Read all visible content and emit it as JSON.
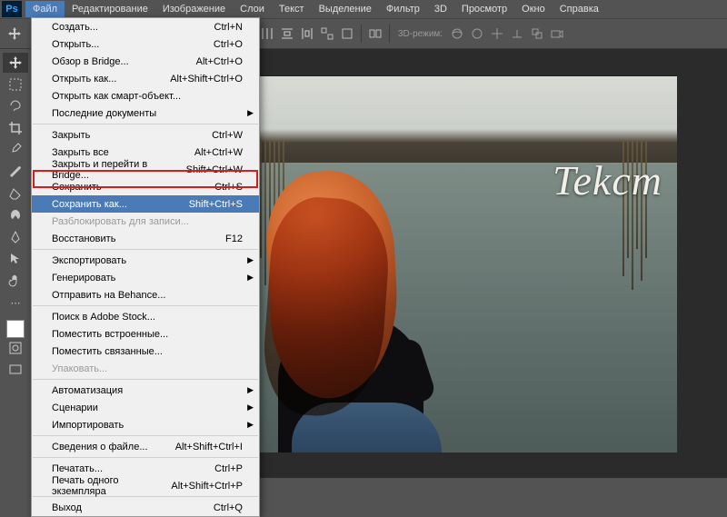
{
  "app": {
    "logo": "Ps"
  },
  "menubar": [
    "Файл",
    "Редактирование",
    "Изображение",
    "Слои",
    "Текст",
    "Выделение",
    "Фильтр",
    "3D",
    "Просмотр",
    "Окно",
    "Справка"
  ],
  "active_menu": 0,
  "dropdown": {
    "groups": [
      [
        {
          "label": "Создать...",
          "shortcut": "Ctrl+N"
        },
        {
          "label": "Открыть...",
          "shortcut": "Ctrl+O"
        },
        {
          "label": "Обзор в Bridge...",
          "shortcut": "Alt+Ctrl+O"
        },
        {
          "label": "Открыть как...",
          "shortcut": "Alt+Shift+Ctrl+O"
        },
        {
          "label": "Открыть как смарт-объект..."
        },
        {
          "label": "Последние документы",
          "submenu": true
        }
      ],
      [
        {
          "label": "Закрыть",
          "shortcut": "Ctrl+W"
        },
        {
          "label": "Закрыть все",
          "shortcut": "Alt+Ctrl+W"
        },
        {
          "label": "Закрыть и перейти в Bridge...",
          "shortcut": "Shift+Ctrl+W"
        },
        {
          "label": "Сохранить",
          "shortcut": "Ctrl+S"
        },
        {
          "label": "Сохранить как...",
          "shortcut": "Shift+Ctrl+S",
          "highlighted": true
        },
        {
          "label": "Разблокировать для записи...",
          "disabled": true
        },
        {
          "label": "Восстановить",
          "shortcut": "F12"
        }
      ],
      [
        {
          "label": "Экспортировать",
          "submenu": true
        },
        {
          "label": "Генерировать",
          "submenu": true
        },
        {
          "label": "Отправить на Behance..."
        }
      ],
      [
        {
          "label": "Поиск в Adobe Stock..."
        },
        {
          "label": "Поместить встроенные..."
        },
        {
          "label": "Поместить связанные..."
        },
        {
          "label": "Упаковать...",
          "disabled": true
        }
      ],
      [
        {
          "label": "Автоматизация",
          "submenu": true
        },
        {
          "label": "Сценарии",
          "submenu": true
        },
        {
          "label": "Импортировать",
          "submenu": true
        }
      ],
      [
        {
          "label": "Сведения о файле...",
          "shortcut": "Alt+Shift+Ctrl+I"
        }
      ],
      [
        {
          "label": "Печатать...",
          "shortcut": "Ctrl+P"
        },
        {
          "label": "Печать одного экземпляра",
          "shortcut": "Alt+Shift+Ctrl+P"
        }
      ],
      [
        {
          "label": "Выход",
          "shortcut": "Ctrl+Q"
        }
      ]
    ]
  },
  "optbar": {
    "mode3d": "3D-режим:"
  },
  "canvas": {
    "text": "Tekcm"
  },
  "swatches": {
    "fg": "#ffffff",
    "bg": "#000000"
  }
}
